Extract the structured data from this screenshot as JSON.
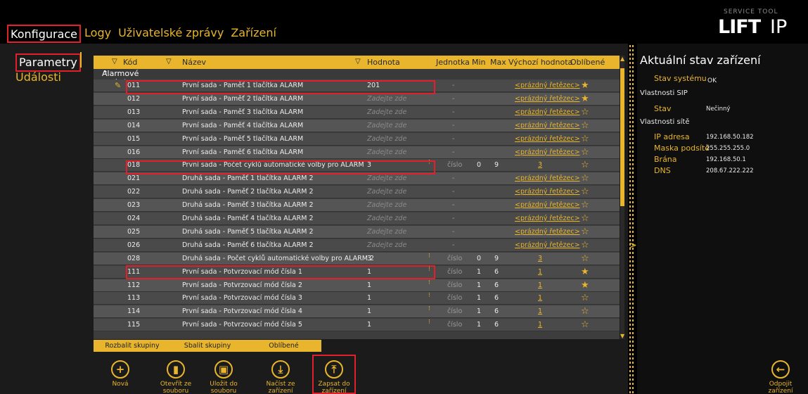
{
  "topnav": {
    "items": [
      "Konfigurace",
      "Logy",
      "Uživatelské zprávy",
      "Zařízení"
    ],
    "active": "Konfigurace"
  },
  "logo": {
    "subtitle": "SERVICE TOOL",
    "main": "LIFT",
    "suffix": "IP"
  },
  "sidebar": {
    "items": [
      "Parametry",
      "Události"
    ],
    "active": "Parametry"
  },
  "grid": {
    "columns": {
      "code": "Kód",
      "name": "Název",
      "value": "Hodnota",
      "unit": "Jednotka",
      "min": "Min",
      "max": "Max",
      "default": "Výchozí hodnota",
      "favorite": "Oblíbené"
    },
    "group_label": "Alarmové volání",
    "group_caret": "⌃",
    "placeholder": "Zadejte zde",
    "rows": [
      {
        "code": "011",
        "name": "První sada - Paměť 1 tlačítka ALARM",
        "value": "201",
        "unit": "-",
        "min": "",
        "max": "",
        "default": "<prázdný řetězec>",
        "star": "★",
        "spin": false,
        "editing": true
      },
      {
        "code": "012",
        "name": "První sada - Paměť 2 tlačítka ALARM",
        "value": "",
        "unit": "-",
        "min": "",
        "max": "",
        "default": "<prázdný řetězec>",
        "star": "★",
        "spin": false,
        "editing": false
      },
      {
        "code": "013",
        "name": "První sada - Paměť 3 tlačítka ALARM",
        "value": "",
        "unit": "-",
        "min": "",
        "max": "",
        "default": "<prázdný řetězec>",
        "star": "☆",
        "spin": false,
        "editing": false
      },
      {
        "code": "014",
        "name": "První sada - Paměť 4 tlačítka ALARM",
        "value": "",
        "unit": "-",
        "min": "",
        "max": "",
        "default": "<prázdný řetězec>",
        "star": "☆",
        "spin": false,
        "editing": false
      },
      {
        "code": "015",
        "name": "První sada - Paměť 5 tlačítka ALARM",
        "value": "",
        "unit": "-",
        "min": "",
        "max": "",
        "default": "<prázdný řetězec>",
        "star": "☆",
        "spin": false,
        "editing": false
      },
      {
        "code": "016",
        "name": "První sada - Paměť 6 tlačítka ALARM",
        "value": "",
        "unit": "-",
        "min": "",
        "max": "",
        "default": "<prázdný řetězec>",
        "star": "☆",
        "spin": false,
        "editing": false
      },
      {
        "code": "018",
        "name": "První sada - Počet cyklů automatické volby pro ALARM",
        "value": "3",
        "unit": "číslo",
        "min": "0",
        "max": "9",
        "default": "3",
        "star": "☆",
        "spin": true,
        "editing": false
      },
      {
        "code": "021",
        "name": "Druhá sada - Paměť 1 tlačítka ALARM 2",
        "value": "",
        "unit": "-",
        "min": "",
        "max": "",
        "default": "<prázdný řetězec>",
        "star": "☆",
        "spin": false,
        "editing": false
      },
      {
        "code": "022",
        "name": "Druhá sada - Paměť 2 tlačítka ALARM 2",
        "value": "",
        "unit": "-",
        "min": "",
        "max": "",
        "default": "<prázdný řetězec>",
        "star": "☆",
        "spin": false,
        "editing": false
      },
      {
        "code": "023",
        "name": "Druhá sada - Paměť 3 tlačítka ALARM 2",
        "value": "",
        "unit": "-",
        "min": "",
        "max": "",
        "default": "<prázdný řetězec>",
        "star": "☆",
        "spin": false,
        "editing": false
      },
      {
        "code": "024",
        "name": "Druhá sada - Paměť 4 tlačítka ALARM 2",
        "value": "",
        "unit": "-",
        "min": "",
        "max": "",
        "default": "<prázdný řetězec>",
        "star": "☆",
        "spin": false,
        "editing": false
      },
      {
        "code": "025",
        "name": "Druhá sada - Paměť 5 tlačítka ALARM 2",
        "value": "",
        "unit": "-",
        "min": "",
        "max": "",
        "default": "<prázdný řetězec>",
        "star": "☆",
        "spin": false,
        "editing": false
      },
      {
        "code": "026",
        "name": "Druhá sada - Paměť 6 tlačítka ALARM 2",
        "value": "",
        "unit": "-",
        "min": "",
        "max": "",
        "default": "<prázdný řetězec>",
        "star": "☆",
        "spin": false,
        "editing": false
      },
      {
        "code": "028",
        "name": "Druhá sada - Počet cyklů automatické volby pro ALARM 2",
        "value": "3",
        "unit": "číslo",
        "min": "0",
        "max": "9",
        "default": "3",
        "star": "☆",
        "spin": true,
        "editing": false
      },
      {
        "code": "111",
        "name": "První sada - Potvrzovací mód čísla 1",
        "value": "1",
        "unit": "číslo",
        "min": "1",
        "max": "6",
        "default": "1",
        "star": "★",
        "spin": true,
        "editing": false
      },
      {
        "code": "112",
        "name": "První sada - Potvrzovací mód čísla 2",
        "value": "1",
        "unit": "číslo",
        "min": "1",
        "max": "6",
        "default": "1",
        "star": "★",
        "spin": true,
        "editing": false
      },
      {
        "code": "113",
        "name": "První sada - Potvrzovací mód čísla 3",
        "value": "1",
        "unit": "číslo",
        "min": "1",
        "max": "6",
        "default": "1",
        "star": "☆",
        "spin": true,
        "editing": false
      },
      {
        "code": "114",
        "name": "První sada - Potvrzovací mód čísla 4",
        "value": "1",
        "unit": "číslo",
        "min": "1",
        "max": "6",
        "default": "1",
        "star": "☆",
        "spin": true,
        "editing": false
      },
      {
        "code": "115",
        "name": "První sada - Potvrzovací mód čísla 5",
        "value": "1",
        "unit": "číslo",
        "min": "1",
        "max": "6",
        "default": "1",
        "star": "☆",
        "spin": true,
        "editing": false
      }
    ]
  },
  "group_buttons": [
    "Rozbalit skupiny",
    "Sbalit skupiny",
    "Oblíbené"
  ],
  "actions": [
    {
      "icon": "+",
      "label": "Nová"
    },
    {
      "icon": "▮",
      "label": "Otevřít ze souboru"
    },
    {
      "icon": "▣",
      "label": "Uložit do souboru"
    },
    {
      "icon": "⤓",
      "label": "Načíst ze zařízení"
    },
    {
      "icon": "⤒",
      "label": "Zapsat do zařízení"
    }
  ],
  "disconnect": {
    "icon": "←",
    "label": "Odpojit zařízení"
  },
  "status": {
    "title": "Aktuální stav zařízení",
    "system_state_label": "Stav systému",
    "system_state_value": "OK",
    "sip_header": "Vlastnosti SIP",
    "sip_state_label": "Stav",
    "sip_state_value": "Nečinný",
    "net_header": "Vlastnosti sítě",
    "ip_label": "IP adresa",
    "ip_value": "192.168.50.182",
    "mask_label": "Maska podsítě",
    "mask_value": "255.255.255.0",
    "gw_label": "Brána",
    "gw_value": "192.168.50.1",
    "dns_label": "DNS",
    "dns_value": "208.67.222.222"
  },
  "colors": {
    "accent": "#e8b52c",
    "highlight": "#e0202a",
    "background": "#000000"
  }
}
